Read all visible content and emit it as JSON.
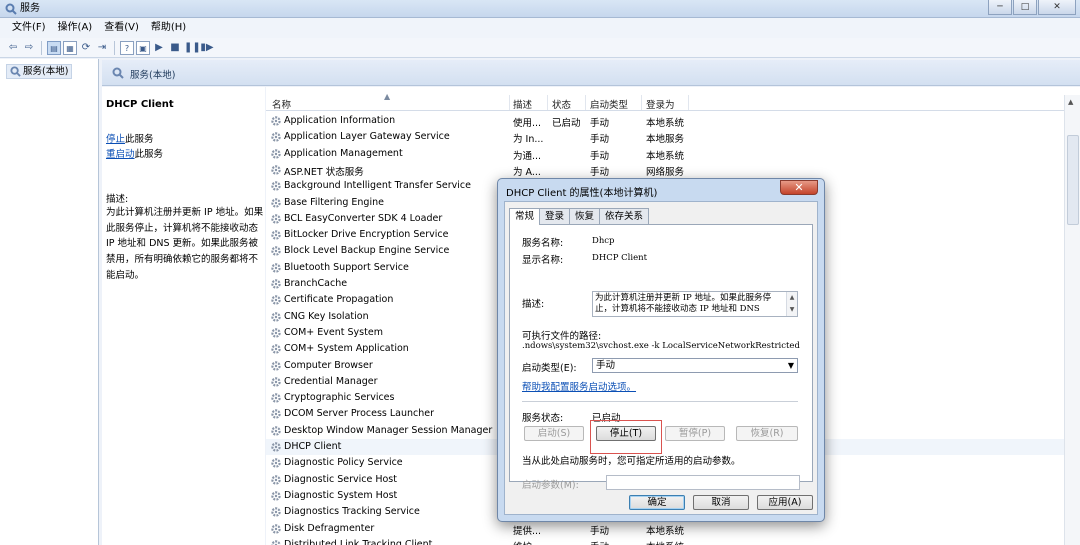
{
  "window": {
    "title": "服务",
    "min": "─",
    "max": "□",
    "close": "✕"
  },
  "menu": [
    "文件(F)",
    "操作(A)",
    "查看(V)",
    "帮助(H)"
  ],
  "tree": {
    "root": "服务(本地)"
  },
  "main_header": "服务(本地)",
  "left_pane": {
    "service_name": "DHCP Client",
    "stop_link": "停止",
    "stop_suffix": "此服务",
    "restart_link": "重启动",
    "restart_suffix": "此服务",
    "desc_label": "描述:",
    "desc_text": "为此计算机注册并更新 IP 地址。如果此服务停止，计算机将不能接收动态 IP 地址和 DNS 更新。如果此服务被禁用，所有明确依赖它的服务都将不能启动。"
  },
  "columns": [
    "名称",
    "描述",
    "状态",
    "启动类型",
    "登录为"
  ],
  "services": [
    {
      "name": "Application Information",
      "desc": "使用...",
      "status": "已启动",
      "startup": "手动",
      "logon": "本地系统"
    },
    {
      "name": "Application Layer Gateway Service",
      "desc": "为 In...",
      "status": "",
      "startup": "手动",
      "logon": "本地服务"
    },
    {
      "name": "Application Management",
      "desc": "为通...",
      "status": "",
      "startup": "手动",
      "logon": "本地系统"
    },
    {
      "name": "ASP.NET 状态服务",
      "desc": "为 A...",
      "status": "",
      "startup": "手动",
      "logon": "网络服务"
    },
    {
      "name": "Background Intelligent Transfer Service",
      "desc": "",
      "status": "",
      "startup": "",
      "logon": ""
    },
    {
      "name": "Base Filtering Engine",
      "desc": "",
      "status": "",
      "startup": "",
      "logon": ""
    },
    {
      "name": "BCL EasyConverter SDK 4 Loader",
      "desc": "",
      "status": "",
      "startup": "",
      "logon": ""
    },
    {
      "name": "BitLocker Drive Encryption Service",
      "desc": "",
      "status": "",
      "startup": "",
      "logon": ""
    },
    {
      "name": "Block Level Backup Engine Service",
      "desc": "",
      "status": "",
      "startup": "",
      "logon": ""
    },
    {
      "name": "Bluetooth Support Service",
      "desc": "",
      "status": "",
      "startup": "",
      "logon": ""
    },
    {
      "name": "BranchCache",
      "desc": "",
      "status": "",
      "startup": "",
      "logon": ""
    },
    {
      "name": "Certificate Propagation",
      "desc": "",
      "status": "",
      "startup": "",
      "logon": ""
    },
    {
      "name": "CNG Key Isolation",
      "desc": "",
      "status": "",
      "startup": "",
      "logon": ""
    },
    {
      "name": "COM+ Event System",
      "desc": "",
      "status": "",
      "startup": "",
      "logon": ""
    },
    {
      "name": "COM+ System Application",
      "desc": "",
      "status": "",
      "startup": "",
      "logon": ""
    },
    {
      "name": "Computer Browser",
      "desc": "",
      "status": "",
      "startup": "",
      "logon": ""
    },
    {
      "name": "Credential Manager",
      "desc": "",
      "status": "",
      "startup": "",
      "logon": ""
    },
    {
      "name": "Cryptographic Services",
      "desc": "",
      "status": "",
      "startup": "",
      "logon": ""
    },
    {
      "name": "DCOM Server Process Launcher",
      "desc": "",
      "status": "",
      "startup": "",
      "logon": ""
    },
    {
      "name": "Desktop Window Manager Session Manager",
      "desc": "",
      "status": "",
      "startup": "",
      "logon": ""
    },
    {
      "name": "DHCP Client",
      "desc": "",
      "status": "",
      "startup": "",
      "logon": ""
    },
    {
      "name": "Diagnostic Policy Service",
      "desc": "",
      "status": "",
      "startup": "",
      "logon": ""
    },
    {
      "name": "Diagnostic Service Host",
      "desc": "",
      "status": "",
      "startup": "",
      "logon": ""
    },
    {
      "name": "Diagnostic System Host",
      "desc": "",
      "status": "",
      "startup": "",
      "logon": ""
    },
    {
      "name": "Diagnostics Tracking Service",
      "desc": "",
      "status": "",
      "startup": "",
      "logon": ""
    },
    {
      "name": "Disk Defragmenter",
      "desc": "提供...",
      "status": "",
      "startup": "手动",
      "logon": "本地系统"
    },
    {
      "name": "Distributed Link Tracking Client",
      "desc": "维护...",
      "status": "",
      "startup": "手动",
      "logon": "本地系统"
    }
  ],
  "dialog": {
    "title": "DHCP Client 的属性(本地计算机)",
    "close": "✕",
    "tabs": [
      "常规",
      "登录",
      "恢复",
      "依存关系"
    ],
    "service_name_label": "服务名称:",
    "service_name_value": "Dhcp",
    "display_name_label": "显示名称:",
    "display_name_value": "DHCP Client",
    "desc_label": "描述:",
    "desc_value": "为此计算机注册并更新 IP 地址。如果此服务停止，计算机将不能接收动态 IP 地址和 DNS",
    "path_label": "可执行文件的路径:",
    "path_value": ".ndows\\system32\\svchost.exe -k LocalServiceNetworkRestricted",
    "startup_label": "启动类型(E):",
    "startup_value": "手动",
    "help_link": "帮助我配置服务启动选项。",
    "status_label": "服务状态:",
    "status_value": "已启动",
    "btn_start": "启动(S)",
    "btn_stop": "停止(T)",
    "btn_pause": "暂停(P)",
    "btn_resume": "恢复(R)",
    "hint": "当从此处启动服务时，您可指定所适用的启动参数。",
    "params_label": "启动参数(M):",
    "params_value": "",
    "btn_ok": "确定",
    "btn_cancel": "取消",
    "btn_apply": "应用(A)"
  }
}
